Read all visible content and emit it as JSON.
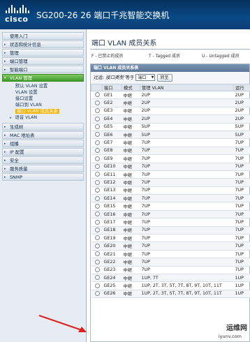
{
  "header": {
    "logo_text": "cisco",
    "title": "SG200-26 26 端口千兆智能交换机"
  },
  "sidebar": {
    "items": [
      {
        "label": "使用入门",
        "caret": ""
      },
      {
        "label": "状态和统计信息",
        "caret": "▸"
      },
      {
        "label": "管理",
        "caret": "▸"
      },
      {
        "label": "端口管理",
        "caret": "▸"
      },
      {
        "label": "智能端口",
        "caret": "▸"
      },
      {
        "label": "VLAN 管理",
        "caret": "▾"
      }
    ],
    "vlan_sub": [
      {
        "label": "默认 VLAN 设置"
      },
      {
        "label": "VLAN 设置"
      },
      {
        "label": "接口设置"
      },
      {
        "label": "端口到 VLAN"
      },
      {
        "label": "端口 VLAN 成员关系"
      },
      {
        "label": "语音 VLAN"
      }
    ],
    "items_after": [
      {
        "label": "生成树",
        "caret": "▸"
      },
      {
        "label": "MAC 地址表",
        "caret": "▸"
      },
      {
        "label": "组播",
        "caret": "▸"
      },
      {
        "label": "IP 配置",
        "caret": "▸"
      },
      {
        "label": "安全",
        "caret": "▸"
      },
      {
        "label": "服务质量",
        "caret": "▸"
      },
      {
        "label": "SNMP",
        "caret": "▸"
      }
    ]
  },
  "main": {
    "page_title": "端口 VLAN 成员关系",
    "legend": {
      "forbidden": "F - 已禁止的成员",
      "tagged": "T - Tagged 成员",
      "untagged": "U - Untagged 成员"
    },
    "table_caption": "端口 VLAN 成员关系表",
    "filter": {
      "label": "过滤:",
      "field": "接口类型",
      "equals": "等于",
      "select_value": "端口",
      "go_button": "转至"
    },
    "columns": [
      "接口",
      "模式",
      "管理 VLAN",
      "运行"
    ],
    "rows": [
      {
        "port": "GE1",
        "mode": "中继",
        "admin": "2UP",
        "oper": "2UP"
      },
      {
        "port": "GE2",
        "mode": "中继",
        "admin": "2UP",
        "oper": "2UP"
      },
      {
        "port": "GE3",
        "mode": "中继",
        "admin": "2UP",
        "oper": "2UP"
      },
      {
        "port": "GE4",
        "mode": "中继",
        "admin": "2UP",
        "oper": "2UP"
      },
      {
        "port": "GE5",
        "mode": "中继",
        "admin": "5UP",
        "oper": "5UP"
      },
      {
        "port": "GE6",
        "mode": "中继",
        "admin": "5UP",
        "oper": "5UP"
      },
      {
        "port": "GE7",
        "mode": "中继",
        "admin": "7UP",
        "oper": "7UP"
      },
      {
        "port": "GE8",
        "mode": "中继",
        "admin": "7UP",
        "oper": "7UP"
      },
      {
        "port": "GE9",
        "mode": "中继",
        "admin": "7UP",
        "oper": "7UP"
      },
      {
        "port": "GE10",
        "mode": "中继",
        "admin": "7UP",
        "oper": "7UP"
      },
      {
        "port": "GE11",
        "mode": "中继",
        "admin": "7UP",
        "oper": "7UP"
      },
      {
        "port": "GE12",
        "mode": "中继",
        "admin": "7UP",
        "oper": "7UP"
      },
      {
        "port": "GE13",
        "mode": "中继",
        "admin": "7UP",
        "oper": "7UP"
      },
      {
        "port": "GE14",
        "mode": "中继",
        "admin": "7UP",
        "oper": "7UP"
      },
      {
        "port": "GE15",
        "mode": "中继",
        "admin": "7UP",
        "oper": "7UP"
      },
      {
        "port": "GE16",
        "mode": "中继",
        "admin": "7UP",
        "oper": "7UP"
      },
      {
        "port": "GE17",
        "mode": "中继",
        "admin": "7UP",
        "oper": "7UP"
      },
      {
        "port": "GE18",
        "mode": "中继",
        "admin": "7UP",
        "oper": "7UP"
      },
      {
        "port": "GE19",
        "mode": "中继",
        "admin": "7UP",
        "oper": "7UP"
      },
      {
        "port": "GE20",
        "mode": "中继",
        "admin": "7UP",
        "oper": "7UP"
      },
      {
        "port": "GE21",
        "mode": "中继",
        "admin": "7UP",
        "oper": "7UP"
      },
      {
        "port": "GE22",
        "mode": "中继",
        "admin": "7UP",
        "oper": "7UP"
      },
      {
        "port": "GE23",
        "mode": "中继",
        "admin": "7UP",
        "oper": "7UP"
      },
      {
        "port": "GE24",
        "mode": "中继",
        "admin": "1UP, 7T",
        "oper": "1UP"
      },
      {
        "port": "GE25",
        "mode": "中继",
        "admin": "1UP, 2T, 3T, 5T, 7T, 8T, 9T, 10T, 11T",
        "oper": "1UP"
      },
      {
        "port": "GE26",
        "mode": "中继",
        "admin": "1UP, 2T, 3T, 5T, 7T, 8T, 9T, 10T, 11T",
        "oper": "1UP"
      }
    ]
  },
  "watermark": {
    "text": "运维网",
    "url": "iyunv.com"
  },
  "colors": {
    "header_bg": "#0a4a86",
    "active_nav": "#4aa534",
    "current_sub": "#f5b50a",
    "table_caption_bg": "#6a84a4",
    "annotation_arrow": "#e02020"
  }
}
